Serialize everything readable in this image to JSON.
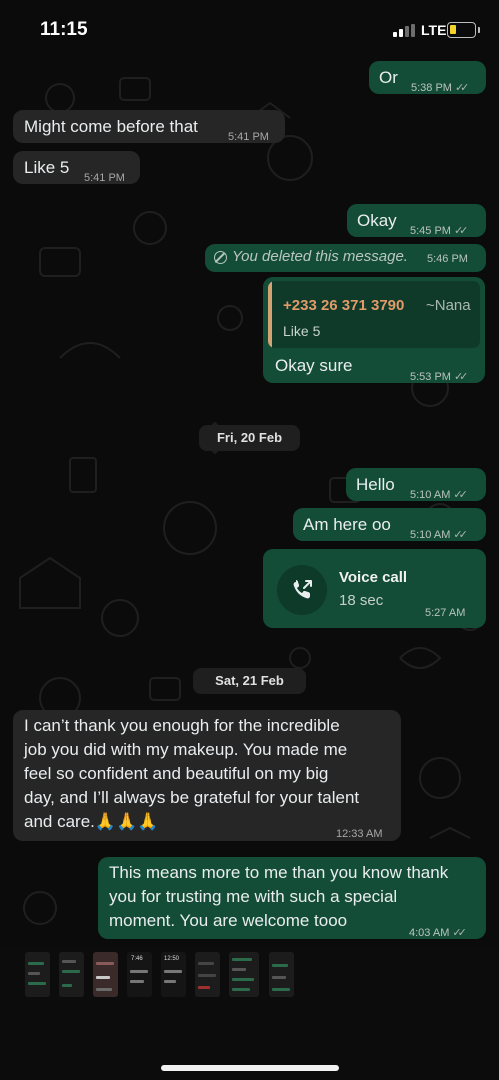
{
  "status_bar": {
    "time": "11:15",
    "network": "LTE",
    "battery_level": 0.25,
    "battery_color": "#f4d32d"
  },
  "colors": {
    "outgoing_bubble": "#144d37",
    "incoming_bubble": "#262626",
    "background": "#0b0b0b",
    "quoted_author": "#e09b68"
  },
  "messages": [
    {
      "dir": "out",
      "text": "Or",
      "time": "5:38 PM",
      "status": "read"
    },
    {
      "dir": "in",
      "text": "Might come before that",
      "time": "5:41 PM"
    },
    {
      "dir": "in",
      "text": "Like 5",
      "time": "5:41 PM"
    },
    {
      "dir": "out",
      "text": "Okay",
      "time": "5:45 PM",
      "status": "read"
    },
    {
      "dir": "out",
      "deleted": true,
      "text": "You deleted this message.",
      "time": "5:46 PM"
    },
    {
      "dir": "out",
      "quoted": {
        "author": "+233 26 371 3790",
        "author_name": "~Nana",
        "text": "Like 5"
      },
      "text": "Okay sure",
      "time": "5:53 PM",
      "status": "read"
    }
  ],
  "date_1": "Fri, 20 Feb",
  "messages_2": [
    {
      "dir": "out",
      "text": "Hello",
      "time": "5:10 AM",
      "status": "read"
    },
    {
      "dir": "out",
      "text": "Am here oo",
      "time": "5:10 AM",
      "status": "read"
    },
    {
      "dir": "out",
      "call": {
        "title": "Voice call",
        "duration": "18 sec",
        "icon": "outgoing-call-icon"
      },
      "time": "5:27 AM"
    }
  ],
  "date_2": "Sat, 21 Feb",
  "messages_3": [
    {
      "dir": "in",
      "lines": [
        "I can’t thank you enough for the incredible",
        "job you did with my makeup. You made me",
        "feel so confident and beautiful on my big",
        "day, and I’ll always be grateful for your talent",
        "and care.🙏🙏🙏"
      ],
      "time": "12:33 AM"
    },
    {
      "dir": "out",
      "lines": [
        "This means more to me than you know thank",
        "you for trusting me with such a special",
        "moment. You are welcome tooo"
      ],
      "time": "4:03 AM",
      "status": "read"
    }
  ],
  "thumbnails": [
    {
      "icon": "screenshot-thumbnail-icon"
    },
    {
      "icon": "screenshot-thumbnail-icon"
    },
    {
      "icon": "screenshot-thumbnail-icon"
    },
    {
      "icon": "screenshot-thumbnail-icon",
      "text": "7:46"
    },
    {
      "icon": "screenshot-thumbnail-icon",
      "text": "12:50"
    },
    {
      "icon": "screenshot-thumbnail-icon"
    },
    {
      "icon": "screenshot-thumbnail-icon"
    },
    {
      "icon": "screenshot-thumbnail-icon"
    }
  ]
}
